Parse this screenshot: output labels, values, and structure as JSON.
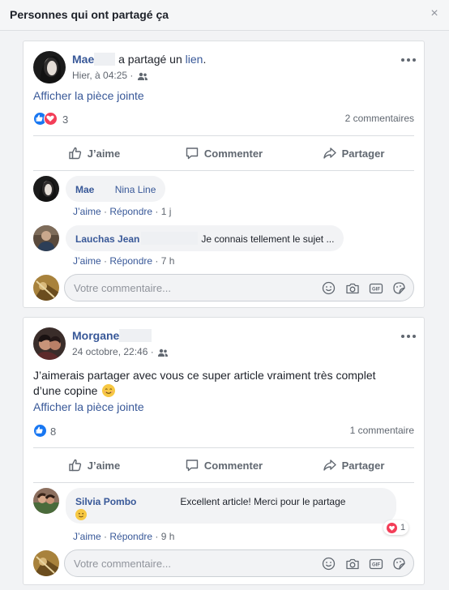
{
  "dialog": {
    "title": "Personnes qui ont partagé ça",
    "close_glyph": "×"
  },
  "posts": [
    {
      "author": "Mae",
      "shared_text": "a partagé un",
      "shared_link": "lien",
      "shared_period": ".",
      "time": "Hier, à 04:25",
      "audience_icon": "friends-icon",
      "attachment_label": "Afficher la pièce jointe",
      "reaction_count": "3",
      "comment_count": "2 commentaires",
      "actions": {
        "like": "J’aime",
        "comment": "Commenter",
        "share": "Partager"
      },
      "comments": [
        {
          "name": "Mae",
          "text": "Nina Line",
          "like": "J’aime",
          "reply": "Répondre",
          "time": "1 j"
        },
        {
          "name": "Lauchas Jean",
          "text": "Je connais tellement le sujet ...",
          "like": "J’aime",
          "reply": "Répondre",
          "time": "7 h"
        }
      ],
      "composer_placeholder": "Votre commentaire..."
    },
    {
      "author": "Morgane",
      "time": "24 octobre, 22:46",
      "audience_icon": "friends-icon",
      "text_line1": "J’aimerais partager avec vous ce super article vraiment très complet",
      "text_line2": "d’une copine",
      "attachment_label": "Afficher la pièce jointe",
      "reaction_count": "8",
      "comment_count": "1 commentaire",
      "actions": {
        "like": "J’aime",
        "comment": "Commenter",
        "share": "Partager"
      },
      "comments": [
        {
          "name": "Silvia Pombo",
          "text": "Excellent article! Merci pour le partage",
          "like": "J’aime",
          "reply": "Répondre",
          "time": "9 h",
          "reaction_count": "1"
        }
      ],
      "composer_placeholder": "Votre commentaire..."
    }
  ],
  "composer_icons": [
    "emoji-icon",
    "camera-icon",
    "gif-icon",
    "sticker-icon"
  ],
  "colors": {
    "link": "#385898",
    "like": "#1877f2",
    "love": "#f33e58",
    "meta": "#606770"
  }
}
